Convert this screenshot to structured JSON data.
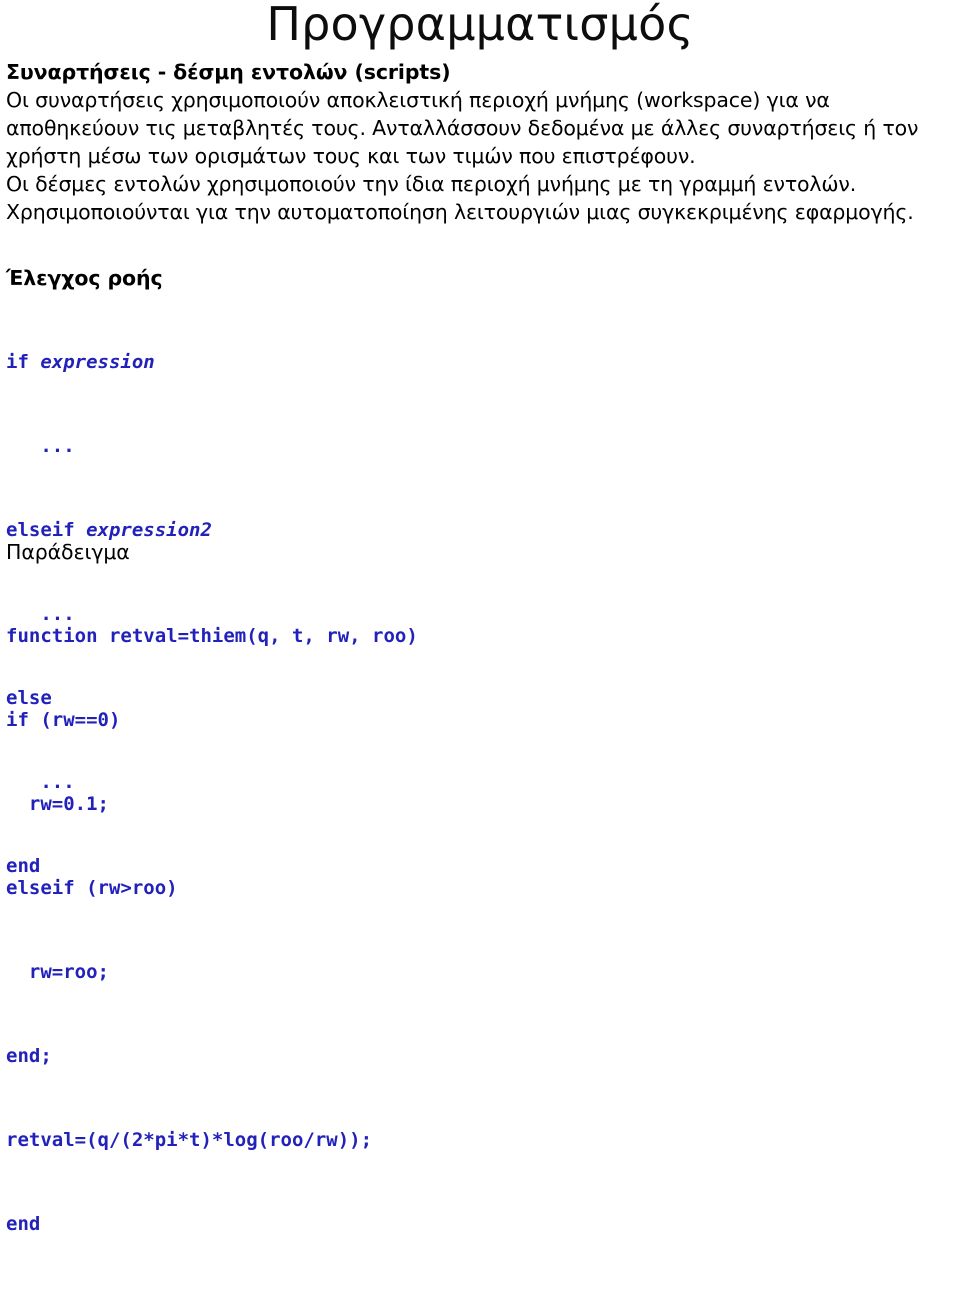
{
  "slide": {
    "title": "Προγραμματισμός",
    "heading": "Συναρτήσεις - δέσμη εντολών (scripts)",
    "paragraph1": [
      "Οι συναρτήσεις χρησιμοποιούν αποκλειστική περιοχή μνήμης (workspace) για να",
      "αποθηκεύουν τις μεταβλητές τους. Ανταλλάσσουν δεδομένα με άλλες συναρτήσεις ή τον",
      "χρήστη μέσω των ορισμάτων τους και των τιμών που επιστρέφουν."
    ],
    "paragraph2": [
      "Οι δέσμες εντολών χρησιμοποιούν την ίδια περιοχή μνήμης με τη γραμμή εντολών.",
      "Χρησιμοποιούνται για την αυτοματοποίηση λειτουργιών μιας συγκεκριμένης εφαρμογής."
    ],
    "flow_heading": "Έλεγχος ροής",
    "flow_code": [
      {
        "keyword": "if ",
        "arg": "expression"
      },
      {
        "keyword": "   ...",
        "arg": ""
      },
      {
        "keyword": "elseif ",
        "arg": "expression2"
      },
      {
        "keyword": "   ...",
        "arg": ""
      },
      {
        "keyword": "else",
        "arg": ""
      },
      {
        "keyword": "   ...",
        "arg": ""
      },
      {
        "keyword": "end",
        "arg": ""
      }
    ],
    "example_heading": "Παράδειγμα",
    "example_code": [
      "function retval=thiem(q, t, rw, roo)",
      "if (rw==0)",
      "  rw=0.1;",
      "elseif (rw>roo)",
      "  rw=roo;",
      "end;",
      "retval=(q/(2*pi*t)*log(roo/rw));",
      "end"
    ]
  },
  "colors": {
    "code": "#2222bb",
    "text": "#000000",
    "background": "#ffffff"
  }
}
